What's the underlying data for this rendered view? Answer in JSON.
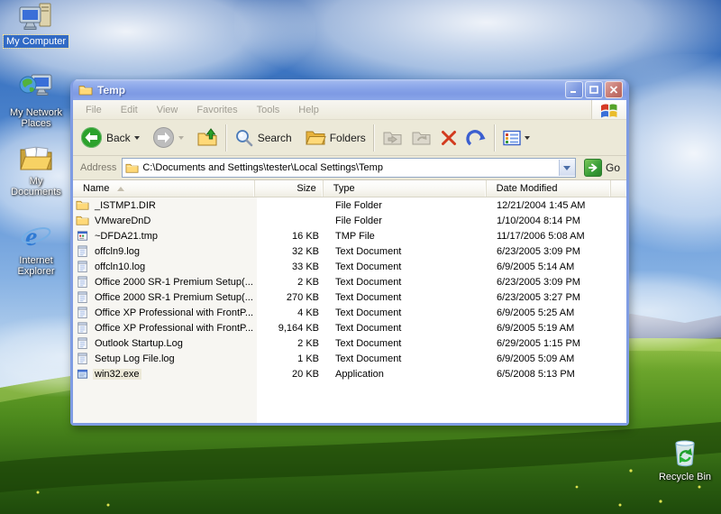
{
  "desktop": {
    "icons": [
      {
        "label": "My Computer",
        "selected": true
      },
      {
        "label": "My Network Places",
        "selected": false
      },
      {
        "label": "My Documents",
        "selected": false
      },
      {
        "label": "Internet Explorer",
        "selected": false
      },
      {
        "label": "Recycle Bin",
        "selected": false
      }
    ]
  },
  "colors": {
    "selection_blue": "#316ac5",
    "titlebar_blue": "#87a3e8",
    "delete_red": "#d23a1e",
    "go_green": "#379d37",
    "folder_yellow": "#ffd978"
  },
  "window": {
    "title": "Temp",
    "menu": [
      "File",
      "Edit",
      "View",
      "Favorites",
      "Tools",
      "Help"
    ],
    "toolbar": {
      "back_label": "Back",
      "search_label": "Search",
      "folders_label": "Folders"
    },
    "address": {
      "label": "Address",
      "value": "C:\\Documents and Settings\\tester\\Local Settings\\Temp",
      "go_label": "Go"
    },
    "columns": [
      "Name",
      "Size",
      "Type",
      "Date Modified"
    ],
    "files": [
      {
        "name": "_ISTMP1.DIR",
        "size": "",
        "type": "File Folder",
        "modified": "12/21/2004 1:45 AM",
        "icon": "folder",
        "highlighted": false
      },
      {
        "name": "VMwareDnD",
        "size": "",
        "type": "File Folder",
        "modified": "1/10/2004 8:14 PM",
        "icon": "folder",
        "highlighted": false
      },
      {
        "name": "~DFDA21.tmp",
        "size": "16 KB",
        "type": "TMP File",
        "modified": "11/17/2006 5:08 AM",
        "icon": "tmp",
        "highlighted": false
      },
      {
        "name": "offcln9.log",
        "size": "32 KB",
        "type": "Text Document",
        "modified": "6/23/2005 3:09 PM",
        "icon": "text",
        "highlighted": false
      },
      {
        "name": "offcln10.log",
        "size": "33 KB",
        "type": "Text Document",
        "modified": "6/9/2005 5:14 AM",
        "icon": "text",
        "highlighted": false
      },
      {
        "name": "Office 2000 SR-1 Premium Setup(...",
        "size": "2 KB",
        "type": "Text Document",
        "modified": "6/23/2005 3:09 PM",
        "icon": "text",
        "highlighted": false
      },
      {
        "name": "Office 2000 SR-1 Premium Setup(...",
        "size": "270 KB",
        "type": "Text Document",
        "modified": "6/23/2005 3:27 PM",
        "icon": "text",
        "highlighted": false
      },
      {
        "name": "Office XP Professional with FrontP...",
        "size": "4 KB",
        "type": "Text Document",
        "modified": "6/9/2005 5:25 AM",
        "icon": "text",
        "highlighted": false
      },
      {
        "name": "Office XP Professional with FrontP...",
        "size": "9,164 KB",
        "type": "Text Document",
        "modified": "6/9/2005 5:19 AM",
        "icon": "text",
        "highlighted": false
      },
      {
        "name": "Outlook Startup.Log",
        "size": "2 KB",
        "type": "Text Document",
        "modified": "6/29/2005 1:15 PM",
        "icon": "text",
        "highlighted": false
      },
      {
        "name": "Setup Log File.log",
        "size": "1 KB",
        "type": "Text Document",
        "modified": "6/9/2005 5:09 AM",
        "icon": "text",
        "highlighted": false
      },
      {
        "name": "win32.exe",
        "size": "20 KB",
        "type": "Application",
        "modified": "6/5/2008 5:13 PM",
        "icon": "app",
        "highlighted": true
      }
    ]
  }
}
